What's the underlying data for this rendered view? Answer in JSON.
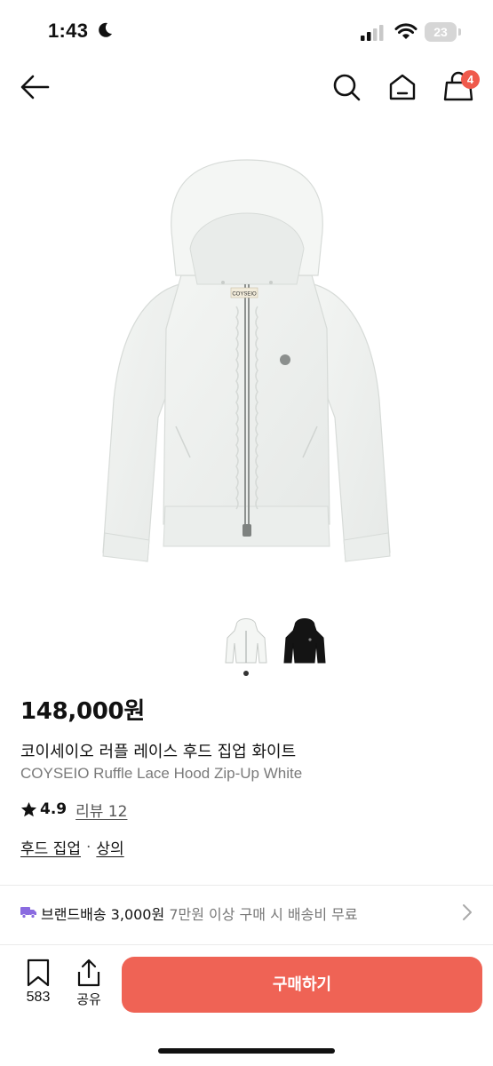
{
  "status_bar": {
    "time": "1:43",
    "battery": "23"
  },
  "nav": {
    "cart_count": "4"
  },
  "product": {
    "price": "148,000원",
    "name_ko": "코이세이오 러플 레이스 후드 집업 화이트",
    "name_en": "COYSEIO Ruffle Lace Hood Zip-Up White",
    "rating": "4.9",
    "reviews_label": "리뷰 12",
    "categories": [
      "후드 집업",
      "상의"
    ],
    "category_separator": "·",
    "brand_label": "COYSEIO"
  },
  "shipping": {
    "main": "브랜드배송 3,000원",
    "note": "7만원 이상 구매 시 배송비 무료"
  },
  "bottom_bar": {
    "wish_count": "583",
    "share_label": "공유",
    "buy_label": "구매하기"
  },
  "colors": {
    "accent": "#ef6355",
    "badge": "#ef5a4c",
    "truck": "#8a6be0"
  },
  "icons": [
    "back-arrow-icon",
    "search-icon",
    "home-icon",
    "shopping-bag-icon",
    "star-icon",
    "truck-icon",
    "chevron-right-icon",
    "bookmark-icon",
    "share-icon"
  ]
}
